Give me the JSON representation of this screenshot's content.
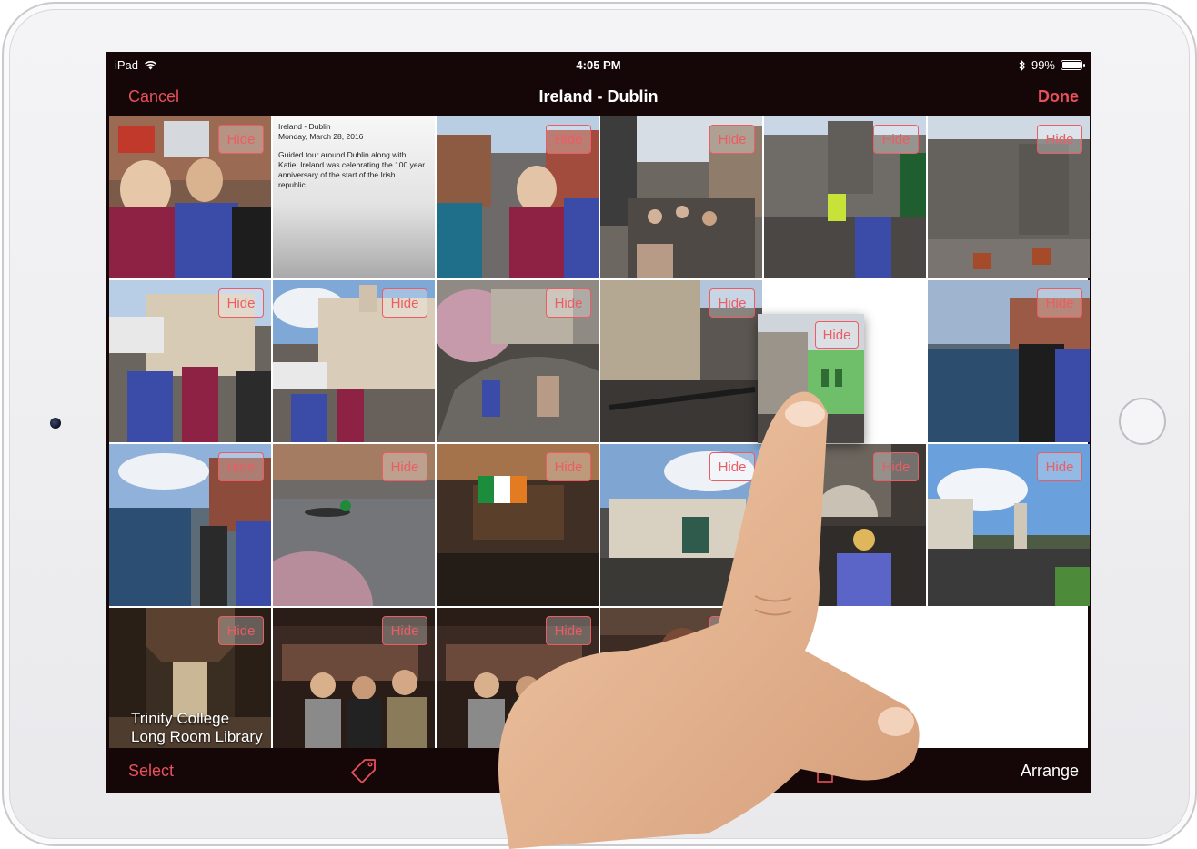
{
  "status_bar": {
    "device": "iPad",
    "time": "4:05 PM",
    "battery": "99%",
    "battery_level": 0.99
  },
  "nav": {
    "cancel_label": "Cancel",
    "title": "Ireland - Dublin",
    "done_label": "Done"
  },
  "hide_label": "Hide",
  "note": {
    "title": "Ireland - Dublin",
    "date": "Monday, March 28, 2016",
    "body": "Guided tour around Dublin along with Katie. Ireland was celebrating the 100 year anniversary of the start of the Irish republic."
  },
  "captions": {
    "trinity_line1": "Trinity College",
    "trinity_line2": "Long Room Library"
  },
  "toolbar": {
    "select_label": "Select",
    "arrange_label": "Arrange",
    "tag_icon": "tag-icon",
    "trash_icon": "trash-icon"
  },
  "colors": {
    "accent": "#e8505b",
    "bar_bg": "#150707"
  },
  "icons": {
    "wifi": "wifi-icon",
    "bluetooth": "bluetooth-icon",
    "battery": "battery-icon"
  }
}
